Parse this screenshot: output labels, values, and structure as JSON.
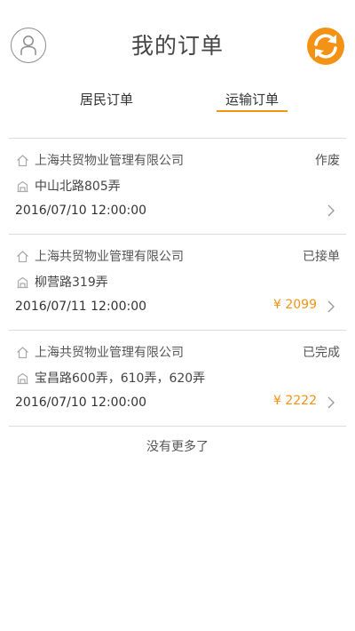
{
  "header": {
    "title": "我的订单",
    "accent_color": "#f39214"
  },
  "tabs": [
    {
      "label": "居民订单",
      "active": false
    },
    {
      "label": "运输订单",
      "active": true
    }
  ],
  "orders": [
    {
      "company": "上海共贸物业管理有限公司",
      "address": "中山北路805弄",
      "datetime": "2016/07/10 12:00:00",
      "status": "作废",
      "price": ""
    },
    {
      "company": "上海共贸物业管理有限公司",
      "address": "柳营路319弄",
      "datetime": "2016/07/11 12:00:00",
      "status": "已接单",
      "price": "¥ 2099"
    },
    {
      "company": "上海共贸物业管理有限公司",
      "address": "宝昌路600弄，610弄，620弄",
      "datetime": "2016/07/10 12:00:00",
      "status": "已完成",
      "price": "¥ 2222"
    }
  ],
  "footer": {
    "no_more_text": "没有更多了"
  }
}
